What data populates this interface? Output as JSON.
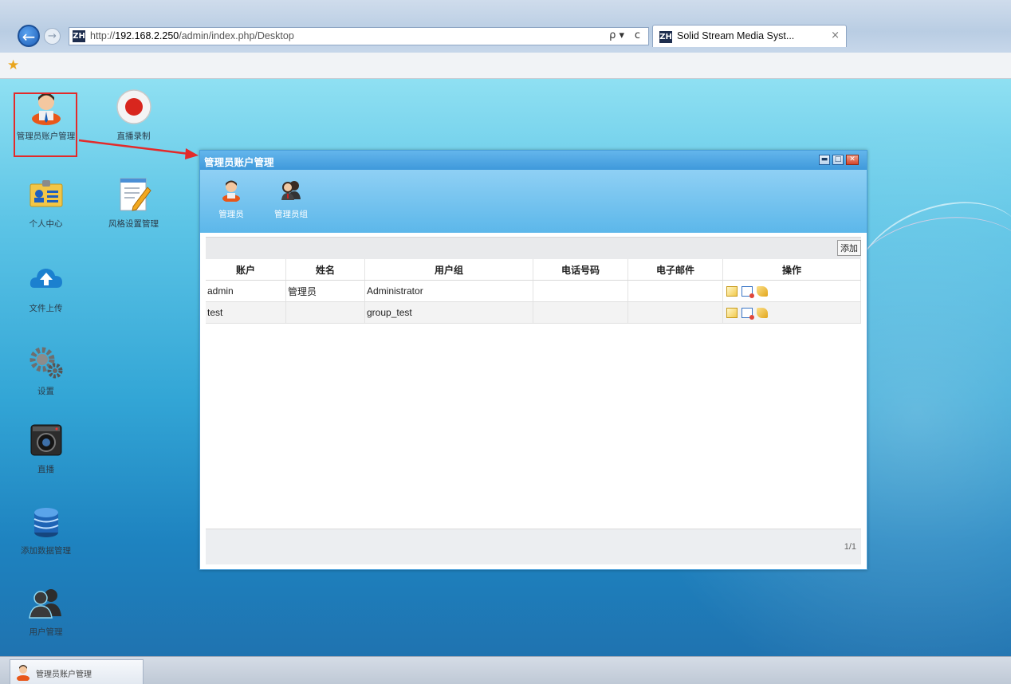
{
  "browser": {
    "url_prefix": "http://",
    "url_host": "192.168.2.250",
    "url_path": "/admin/index.php/Desktop",
    "search_glyph": "ρ ▾",
    "refresh_glyph": "ᴄ",
    "site_icon_text": "ZH",
    "tab_title": "Solid Stream Media Syst...",
    "tab_close": "×"
  },
  "desktop": {
    "icons": [
      {
        "label": "管理员账户管理",
        "icon": "admin-user-icon"
      },
      {
        "label": "直播录制",
        "icon": "record-icon"
      },
      {
        "label": "个人中心",
        "icon": "id-card-icon"
      },
      {
        "label": "风格设置管理",
        "icon": "notepad-icon"
      },
      {
        "label": "文件上传",
        "icon": "cloud-upload-icon"
      },
      {
        "label": "设置",
        "icon": "gears-icon"
      },
      {
        "label": "直播",
        "icon": "camera-icon"
      },
      {
        "label": "添加数据管理",
        "icon": "database-icon"
      },
      {
        "label": "用户管理",
        "icon": "users-icon"
      }
    ]
  },
  "window": {
    "title": "管理员账户管理",
    "controls": {
      "minimize": "▬",
      "maximize": "□",
      "close": "✕"
    },
    "toolbar": [
      {
        "label": "管理员",
        "icon": "admin-icon"
      },
      {
        "label": "管理员组",
        "icon": "admin-group-icon"
      }
    ],
    "add_button": "添加",
    "columns": [
      "账户",
      "姓名",
      "用户组",
      "电话号码",
      "电子邮件",
      "操作"
    ],
    "rows": [
      {
        "account": "admin",
        "name": "管理员",
        "group": "Administrator",
        "phone": "",
        "email": ""
      },
      {
        "account": "test",
        "name": "",
        "group": "group_test",
        "phone": "",
        "email": ""
      }
    ],
    "row_actions": [
      "edit-icon",
      "delete-icon",
      "key-icon"
    ],
    "pager": "1/1"
  },
  "taskbar": {
    "item_label": "管理员账户管理"
  },
  "colors": {
    "window_title": "#4fa7e3",
    "toolbar": "#72c2ef",
    "highlight_box": "#e32a2a"
  }
}
